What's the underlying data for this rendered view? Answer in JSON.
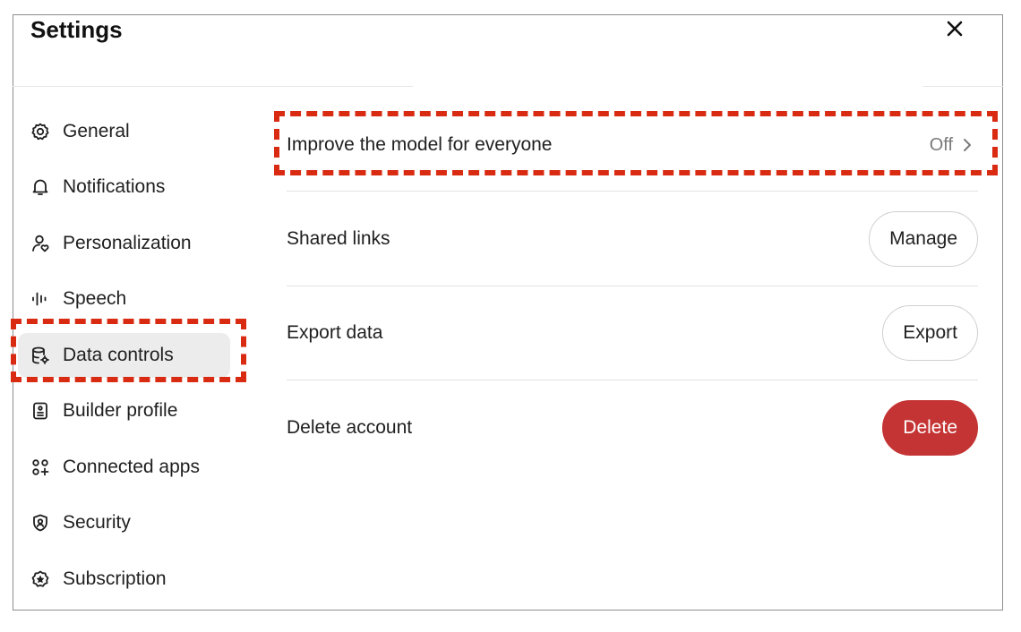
{
  "dialog": {
    "title": "Settings",
    "close_icon": "close-icon"
  },
  "sidebar": {
    "items": [
      {
        "label": "General",
        "icon": "gear-icon",
        "active": false
      },
      {
        "label": "Notifications",
        "icon": "bell-icon",
        "active": false
      },
      {
        "label": "Personalization",
        "icon": "person-heart-icon",
        "active": false
      },
      {
        "label": "Speech",
        "icon": "waveform-icon",
        "active": false
      },
      {
        "label": "Data controls",
        "icon": "database-gear-icon",
        "active": true
      },
      {
        "label": "Builder profile",
        "icon": "id-card-icon",
        "active": false
      },
      {
        "label": "Connected apps",
        "icon": "apps-grid-icon",
        "active": false
      },
      {
        "label": "Security",
        "icon": "shield-icon",
        "active": false
      },
      {
        "label": "Subscription",
        "icon": "badge-icon",
        "active": false
      }
    ]
  },
  "main": {
    "improve_model": {
      "label": "Improve the model for everyone",
      "value": "Off"
    },
    "shared_links": {
      "label": "Shared links",
      "button": "Manage"
    },
    "export_data": {
      "label": "Export data",
      "button": "Export"
    },
    "delete_account": {
      "label": "Delete account",
      "button": "Delete"
    }
  },
  "colors": {
    "annotation": "#d92b12",
    "danger": "#c53434",
    "active_bg": "#ececec"
  }
}
